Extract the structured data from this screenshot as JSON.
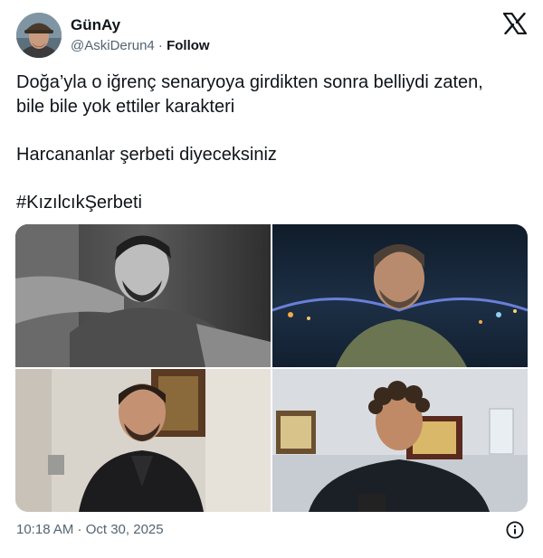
{
  "author": {
    "display_name": "GünAy",
    "handle": "@AskiDerun4",
    "separator": " · ",
    "follow_label": "Follow"
  },
  "tweet": {
    "line1": "Doğa’yla o iğrenç senaryoya girdikten sonra belliydi zaten,",
    "line2": "bile bile yok ettiler karakteri",
    "line3": "Harcananlar şerbeti diyeceksiniz",
    "hashtag": "#KızılcıkŞerbeti"
  },
  "media": {
    "photo_count": 4
  },
  "timestamp": "10:18 AM · Oct 30, 2025",
  "icons": {
    "platform": "x-logo-icon",
    "info": "info-icon"
  },
  "colors": {
    "text_primary": "#0f1419",
    "text_secondary": "#536471"
  }
}
